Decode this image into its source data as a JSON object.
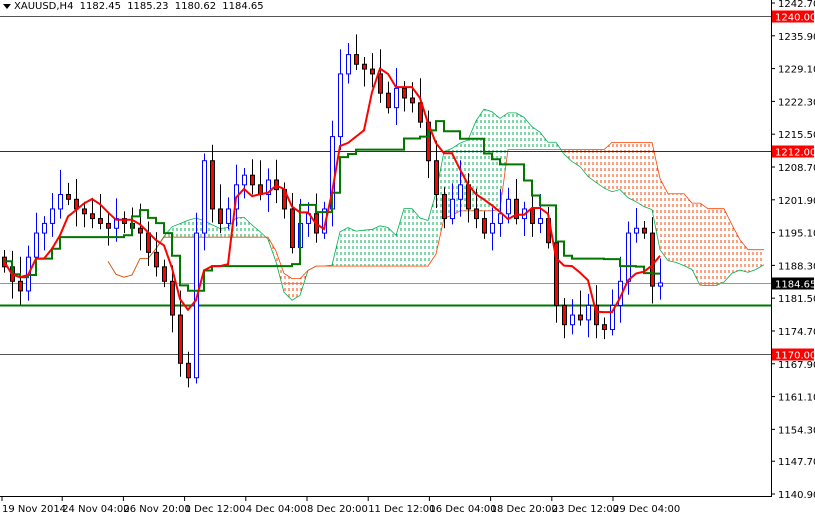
{
  "header": {
    "symbol_timeframe": "XAUUSD,H4",
    "open": "1182.45",
    "high": "1185.23",
    "low": "1180.62",
    "close": "1184.65"
  },
  "chart_data": {
    "type": "candlestick",
    "title": "XAUUSD,H4",
    "ylim": [
      1140.9,
      1242.7
    ],
    "y_ticks": [
      "1242.70",
      "1235.90",
      "1229.10",
      "1222.30",
      "1215.50",
      "1208.70",
      "1201.90",
      "1195.10",
      "1188.30",
      "1181.50",
      "1174.70",
      "1167.90",
      "1161.10",
      "1154.30",
      "1147.70",
      "1140.90"
    ],
    "x_ticks": [
      {
        "label": "19 Nov 2014",
        "index": 0
      },
      {
        "label": "24 Nov 04:00",
        "index": 8
      },
      {
        "label": "26 Nov 20:00",
        "index": 16
      },
      {
        "label": "1 Dec 12:00",
        "index": 24
      },
      {
        "label": "4 Dec 04:00",
        "index": 32
      },
      {
        "label": "8 Dec 20:00",
        "index": 40
      },
      {
        "label": "11 Dec 12:00",
        "index": 48
      },
      {
        "label": "16 Dec 04:00",
        "index": 56
      },
      {
        "label": "18 Dec 20:00",
        "index": 64
      },
      {
        "label": "23 Dec 12:00",
        "index": 72
      },
      {
        "label": "29 Dec 04:00",
        "index": 80
      }
    ],
    "closes": [
      1188,
      1185,
      1183,
      1190,
      1195,
      1197,
      1200,
      1203,
      1202,
      1200,
      1199,
      1198,
      1197,
      1196,
      1198,
      1197,
      1196,
      1195,
      1191,
      1188,
      1185,
      1178,
      1168,
      1165,
      1195,
      1210,
      1200,
      1197,
      1200,
      1205,
      1207,
      1205,
      1203,
      1206,
      1204,
      1200,
      1192,
      1197,
      1199,
      1195,
      1200,
      1215,
      1228,
      1232,
      1230,
      1229,
      1228,
      1224,
      1221,
      1225,
      1223,
      1222,
      1218,
      1210,
      1203,
      1198,
      1202,
      1205,
      1200,
      1198,
      1195,
      1197,
      1199,
      1202,
      1198,
      1200,
      1197,
      1198,
      1193,
      1180,
      1176,
      1178,
      1177,
      1180,
      1176,
      1175,
      1180,
      1185,
      1195,
      1196,
      1195,
      1184,
      1184.65
    ],
    "first_open": 1190,
    "ichimoku": {
      "tenkan_period": 5,
      "kijun_period": 13,
      "senkou_b_period": 26,
      "shift": 13
    },
    "horizontal_levels": [
      {
        "value": 1240.0,
        "label": "1240.00",
        "color": "#ff0000"
      },
      {
        "value": 1212.0,
        "label": "1212.00",
        "color": "#ff0000"
      },
      {
        "value": 1170.0,
        "label": "1170.00",
        "color": "#ff0000"
      }
    ],
    "support_line": 1180.1,
    "current_price": {
      "value": 1184.65,
      "label": "1184.65"
    },
    "colors": {
      "bull": "#0000ff",
      "bear_body": "#ff0000",
      "tenkan": "#ff0000",
      "kijun": "#007800",
      "cloud_up": "#00b050",
      "cloud_down": "#ff4000",
      "support": "#007800"
    }
  }
}
